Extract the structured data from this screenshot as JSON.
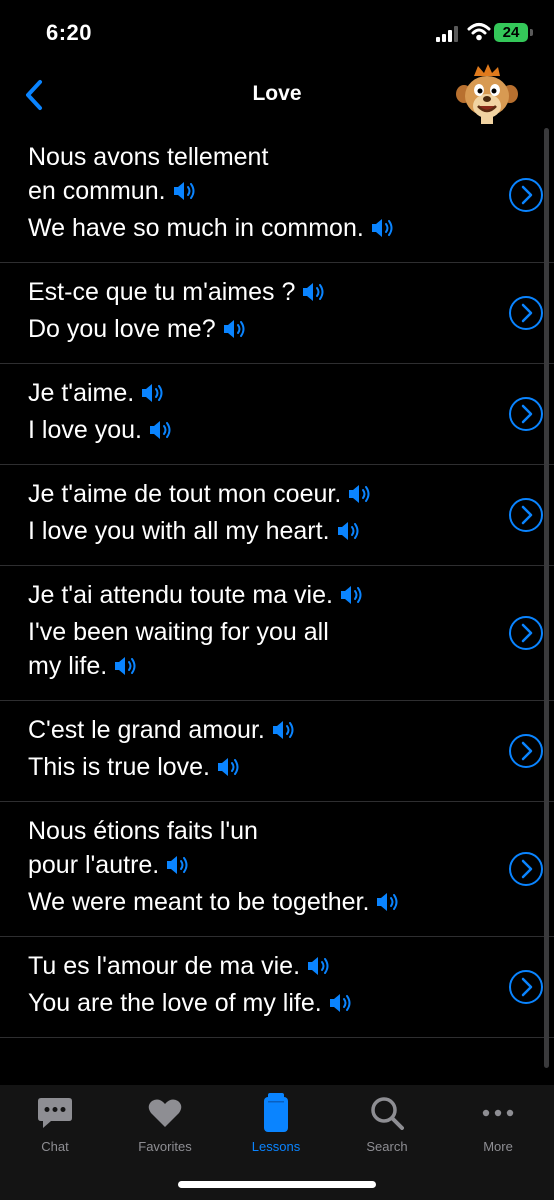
{
  "status_bar": {
    "time": "6:20",
    "battery": "24"
  },
  "nav": {
    "title": "Love",
    "back_icon": "chevron-left-icon",
    "mascot_icon": "meerkat-mascot-icon"
  },
  "colors": {
    "accent": "#0a84ff",
    "battery": "#34c759",
    "background": "#000000",
    "divider": "#2e2e30"
  },
  "phrases": [
    {
      "french_lines": [
        "Nous avons tellement",
        "en commun."
      ],
      "english_lines": [
        "We have so much in common."
      ]
    },
    {
      "french_lines": [
        "Est-ce que tu m'aimes ?"
      ],
      "english_lines": [
        "Do you love me?"
      ]
    },
    {
      "french_lines": [
        "Je t'aime."
      ],
      "english_lines": [
        "I love you."
      ]
    },
    {
      "french_lines": [
        "Je t'aime de tout mon coeur."
      ],
      "english_lines": [
        "I love you with all my heart."
      ]
    },
    {
      "french_lines": [
        "Je t'ai attendu toute ma vie."
      ],
      "english_lines": [
        "I've been waiting for you all",
        "my life."
      ]
    },
    {
      "french_lines": [
        "C'est le grand amour."
      ],
      "english_lines": [
        "This is true love."
      ]
    },
    {
      "french_lines": [
        "Nous étions faits l'un",
        "pour l'autre."
      ],
      "english_lines": [
        "We were meant to be together."
      ]
    },
    {
      "french_lines": [
        "Tu es l'amour de ma vie."
      ],
      "english_lines": [
        "You are the love of my life."
      ]
    }
  ],
  "tabs": [
    {
      "label": "Chat",
      "icon": "chat-bubble-icon",
      "active": false
    },
    {
      "label": "Favorites",
      "icon": "heart-icon",
      "active": false
    },
    {
      "label": "Lessons",
      "icon": "lessons-book-icon",
      "active": true
    },
    {
      "label": "Search",
      "icon": "search-icon",
      "active": false
    },
    {
      "label": "More",
      "icon": "more-dots-icon",
      "active": false
    }
  ]
}
